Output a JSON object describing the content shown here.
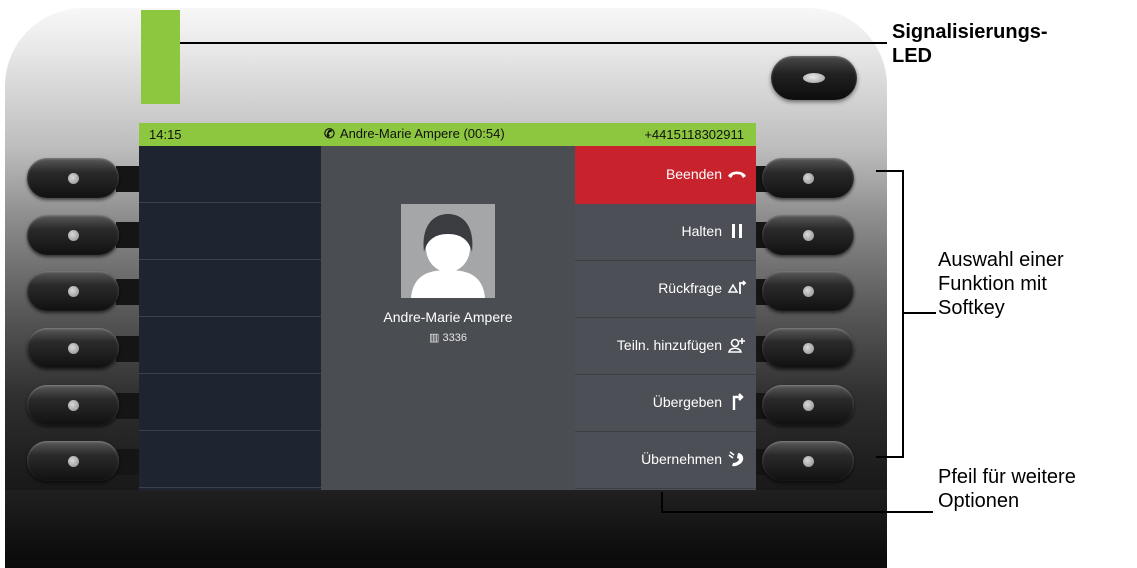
{
  "status_bar": {
    "time": "14:15",
    "call_info": "Andre-Marie Ampere (00:54)",
    "phone_number": "+4415118302911"
  },
  "contact": {
    "name": "Andre-Marie Ampere",
    "extension": "3336"
  },
  "softkeys": [
    {
      "label": "Beenden",
      "icon": "hangup-icon"
    },
    {
      "label": "Halten",
      "icon": "pause-icon"
    },
    {
      "label": "Rückfrage",
      "icon": "consult-icon"
    },
    {
      "label": "Teiln. hinzufügen",
      "icon": "add-participant-icon"
    },
    {
      "label": "Übergeben",
      "icon": "transfer-icon"
    },
    {
      "label": "Übernehmen",
      "icon": "pickup-icon"
    }
  ],
  "annotations": {
    "led": "Signalisierungs-\nLED",
    "softkey_select": "Auswahl einer\nFunktion mit\nSoftkey",
    "more_options": "Pfeil für weitere\nOptionen"
  },
  "colors": {
    "led_green": "#8dc63f",
    "end_call_red": "#c8232c",
    "screen_dark": "#1f2530"
  }
}
